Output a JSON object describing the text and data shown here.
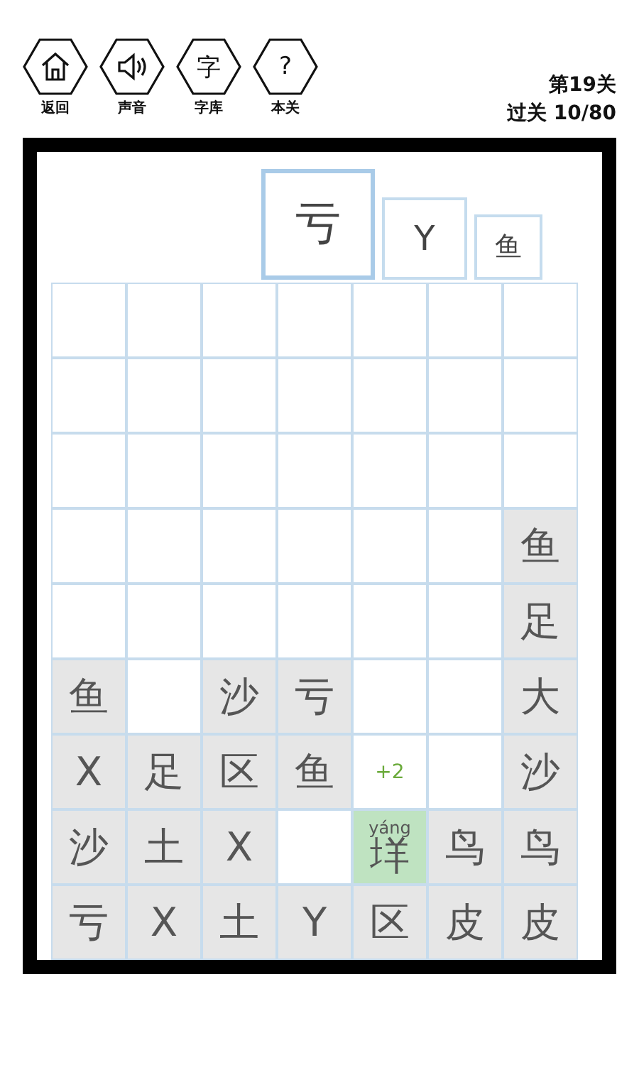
{
  "toolbar": [
    {
      "kind": "home",
      "label": "返回"
    },
    {
      "kind": "sound",
      "label": "声音"
    },
    {
      "kind": "glyph",
      "glyph": "字",
      "label": "字库"
    },
    {
      "kind": "glyph",
      "glyph": "?",
      "label": "本关"
    }
  ],
  "level": {
    "title": "第19关",
    "progress": "过关 10/80"
  },
  "slots": [
    {
      "text": "亏",
      "selected": true
    },
    {
      "text": "Y",
      "selected": false
    },
    {
      "text": "鱼",
      "selected": false
    }
  ],
  "grid": [
    [
      {
        "kind": "empty"
      },
      {
        "kind": "empty"
      },
      {
        "kind": "empty"
      },
      {
        "kind": "empty"
      },
      {
        "kind": "empty"
      },
      {
        "kind": "empty"
      },
      {
        "kind": "empty"
      }
    ],
    [
      {
        "kind": "empty"
      },
      {
        "kind": "empty"
      },
      {
        "kind": "empty"
      },
      {
        "kind": "empty"
      },
      {
        "kind": "empty"
      },
      {
        "kind": "empty"
      },
      {
        "kind": "empty"
      }
    ],
    [
      {
        "kind": "empty"
      },
      {
        "kind": "empty"
      },
      {
        "kind": "empty"
      },
      {
        "kind": "empty"
      },
      {
        "kind": "empty"
      },
      {
        "kind": "empty"
      },
      {
        "kind": "empty"
      }
    ],
    [
      {
        "kind": "empty"
      },
      {
        "kind": "empty"
      },
      {
        "kind": "empty"
      },
      {
        "kind": "empty"
      },
      {
        "kind": "empty"
      },
      {
        "kind": "empty"
      },
      {
        "kind": "tile",
        "text": "鱼"
      }
    ],
    [
      {
        "kind": "empty"
      },
      {
        "kind": "empty"
      },
      {
        "kind": "empty"
      },
      {
        "kind": "empty"
      },
      {
        "kind": "empty"
      },
      {
        "kind": "empty"
      },
      {
        "kind": "tile",
        "text": "足"
      }
    ],
    [
      {
        "kind": "tile",
        "text": "鱼"
      },
      {
        "kind": "empty"
      },
      {
        "kind": "tile",
        "text": "沙"
      },
      {
        "kind": "tile",
        "text": "亏"
      },
      {
        "kind": "empty"
      },
      {
        "kind": "empty"
      },
      {
        "kind": "tile",
        "text": "大"
      }
    ],
    [
      {
        "kind": "tile",
        "text": "X"
      },
      {
        "kind": "tile",
        "text": "足"
      },
      {
        "kind": "tile",
        "text": "区"
      },
      {
        "kind": "tile",
        "text": "鱼"
      },
      {
        "kind": "score",
        "text": "+2"
      },
      {
        "kind": "empty"
      },
      {
        "kind": "tile",
        "text": "沙"
      }
    ],
    [
      {
        "kind": "tile",
        "text": "沙"
      },
      {
        "kind": "tile",
        "text": "土"
      },
      {
        "kind": "tile",
        "text": "X"
      },
      {
        "kind": "empty"
      },
      {
        "kind": "answer",
        "pinyin": "yáng",
        "text": "垟"
      },
      {
        "kind": "tile",
        "text": "鸟"
      },
      {
        "kind": "tile",
        "text": "鸟"
      }
    ],
    [
      {
        "kind": "tile",
        "text": "亏"
      },
      {
        "kind": "tile",
        "text": "X"
      },
      {
        "kind": "tile",
        "text": "土"
      },
      {
        "kind": "tile",
        "text": "Y"
      },
      {
        "kind": "tile",
        "text": "区"
      },
      {
        "kind": "tile",
        "text": "皮"
      },
      {
        "kind": "tile",
        "text": "皮"
      }
    ]
  ]
}
